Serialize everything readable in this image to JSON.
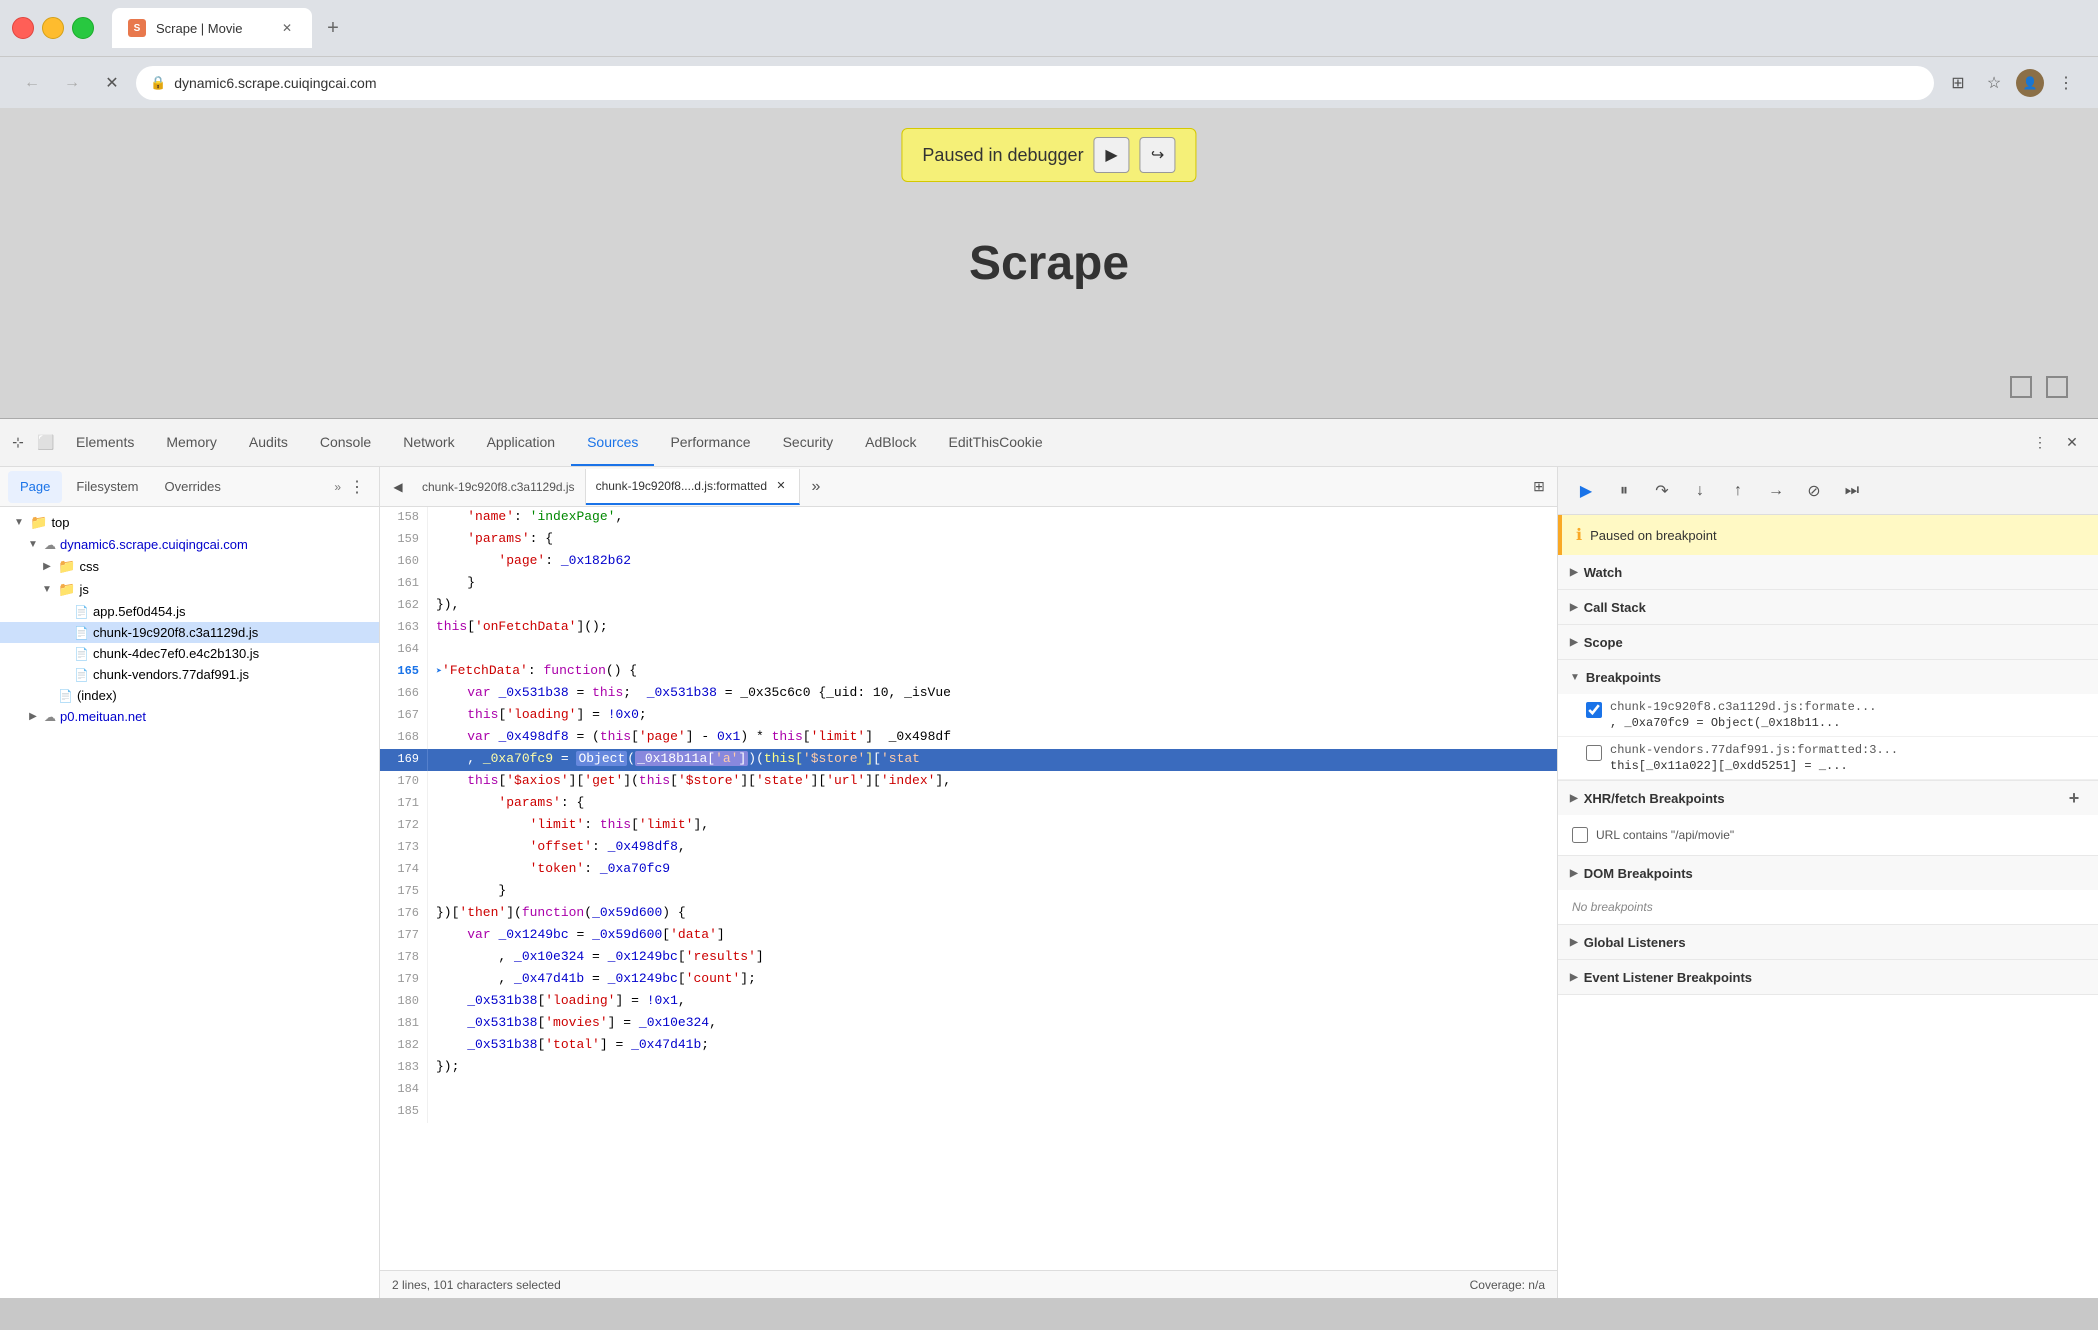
{
  "browser": {
    "title": "Scrape | Movie",
    "url": "dynamic6.scrape.cuiqingcai.com",
    "favicon_label": "S"
  },
  "tabs": [
    {
      "id": "tab1",
      "label": "Scrape | Movie",
      "active": true
    }
  ],
  "webpage": {
    "title": "Scrape",
    "debugger_text": "Paused in debugger"
  },
  "devtools": {
    "tabs": [
      {
        "label": "Elements",
        "active": false
      },
      {
        "label": "Memory",
        "active": false
      },
      {
        "label": "Audits",
        "active": false
      },
      {
        "label": "Console",
        "active": false
      },
      {
        "label": "Network",
        "active": false
      },
      {
        "label": "Application",
        "active": false
      },
      {
        "label": "Sources",
        "active": true
      },
      {
        "label": "Performance",
        "active": false
      },
      {
        "label": "Security",
        "active": false
      },
      {
        "label": "AdBlock",
        "active": false
      },
      {
        "label": "EditThisCookie",
        "active": false
      }
    ]
  },
  "file_panel": {
    "tabs": [
      {
        "label": "Page",
        "active": true
      },
      {
        "label": "Filesystem",
        "active": false
      },
      {
        "label": "Overrides",
        "active": false
      }
    ],
    "tree": [
      {
        "indent": 0,
        "type": "folder",
        "expanded": true,
        "label": "top"
      },
      {
        "indent": 1,
        "type": "cloud-folder",
        "expanded": true,
        "label": "dynamic6.scrape.cuiqingcai.com"
      },
      {
        "indent": 2,
        "type": "folder",
        "expanded": false,
        "label": "css"
      },
      {
        "indent": 2,
        "type": "folder",
        "expanded": true,
        "label": "js"
      },
      {
        "indent": 3,
        "type": "file",
        "label": "app.5ef0d454.js"
      },
      {
        "indent": 3,
        "type": "file",
        "label": "chunk-19c920f8.c3a1129d.js",
        "selected": true
      },
      {
        "indent": 3,
        "type": "file",
        "label": "chunk-4dec7ef0.e4c2b130.js"
      },
      {
        "indent": 3,
        "type": "file",
        "label": "chunk-vendors.77daf991.js"
      },
      {
        "indent": 2,
        "type": "file",
        "label": "(index)"
      },
      {
        "indent": 1,
        "type": "cloud-folder",
        "expanded": false,
        "label": "p0.meituan.net"
      }
    ]
  },
  "code_tabs": [
    {
      "label": "chunk-19c920f8.c3a1129d.js",
      "active": false
    },
    {
      "label": "chunk-19c920f8....d.js:formatted",
      "active": true,
      "closeable": true
    }
  ],
  "code_lines": [
    {
      "num": 158,
      "content": "    'name': 'indexPage',"
    },
    {
      "num": 159,
      "content": "    'params': {"
    },
    {
      "num": 160,
      "content": "        'page': _0x182b62"
    },
    {
      "num": 161,
      "content": "    }"
    },
    {
      "num": 162,
      "content": "}), "
    },
    {
      "num": 163,
      "content": "this['onFetchData']();"
    },
    {
      "num": 164,
      "content": ""
    },
    {
      "num": 165,
      "content": "FetchData': function() {",
      "has_arrow": true
    },
    {
      "num": 166,
      "content": "    var _0x531b38 = this;  _0x531b38 = _0x35c6c0 {_uid: 10, _isVue"
    },
    {
      "num": 167,
      "content": "    this['loading'] = !0x0;"
    },
    {
      "num": 168,
      "content": "    var _0x498df8 = (this['page'] - 0x1) * this['limit']  _0x498df"
    },
    {
      "num": 169,
      "content": "    , _0xa70fc9 = Object(_0x18b11a['a'])(this['$store']['stat",
      "highlighted": true
    },
    {
      "num": 170,
      "content": "    this['$axios']['get'](this['$store']['state']['url']['index'],"
    },
    {
      "num": 171,
      "content": "        'params': {"
    },
    {
      "num": 172,
      "content": "            'limit': this['limit'],"
    },
    {
      "num": 173,
      "content": "            'offset': _0x498df8,"
    },
    {
      "num": 174,
      "content": "            'token': _0xa70fc9"
    },
    {
      "num": 175,
      "content": "        }"
    },
    {
      "num": 176,
      "content": "})['then'](function(_0x59d600) {"
    },
    {
      "num": 177,
      "content": "    var _0x1249bc = _0x59d600['data']"
    },
    {
      "num": 178,
      "content": "        , _0x10e324 = _0x1249bc['results']"
    },
    {
      "num": 179,
      "content": "        , _0x47d41b = _0x1249bc['count'];"
    },
    {
      "num": 180,
      "content": "    _0x531b38['loading'] = !0x1,"
    },
    {
      "num": 181,
      "content": "    _0x531b38['movies'] = _0x10e324,"
    },
    {
      "num": 182,
      "content": "    _0x531b38['total'] = _0x47d41b;"
    },
    {
      "num": 183,
      "content": "});"
    },
    {
      "num": 184,
      "content": ""
    },
    {
      "num": 185,
      "content": ""
    }
  ],
  "status_bar": {
    "left": "2 lines, 101 characters selected",
    "right": "Coverage: n/a"
  },
  "debug_panel": {
    "paused_text": "Paused on breakpoint",
    "sections": [
      {
        "label": "Watch",
        "expanded": false
      },
      {
        "label": "Call Stack",
        "expanded": false
      },
      {
        "label": "Scope",
        "expanded": false
      },
      {
        "label": "Breakpoints",
        "expanded": true
      }
    ],
    "breakpoints": [
      {
        "checked": true,
        "file": "chunk-19c920f8.c3a1129d.js:formate...",
        "code": ", _0xa70fc9 = Object(_0x18b11..."
      },
      {
        "checked": false,
        "file": "chunk-vendors.77daf991.js:formatted:3...",
        "code": "this[_0x11a022][_0xdd5251] = _..."
      }
    ],
    "xhr_breakpoints": [
      {
        "label": "URL contains \"/api/movie\""
      }
    ],
    "dom_breakpoints_label": "DOM Breakpoints",
    "no_breakpoints_text": "No breakpoints",
    "global_listeners_label": "Global Listeners",
    "event_listeners_label": "Event Listener Breakpoints"
  }
}
